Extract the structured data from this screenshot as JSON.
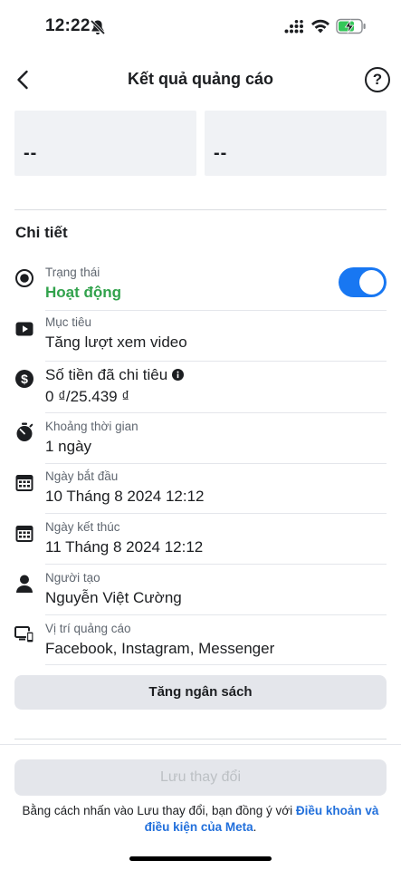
{
  "status_bar": {
    "time": "12:22"
  },
  "header": {
    "title": "Kết quả quảng cáo",
    "help_label": "?"
  },
  "metrics": [
    {
      "value": "--"
    },
    {
      "value": "--"
    }
  ],
  "details": {
    "title": "Chi tiết",
    "rows": [
      {
        "label": "Trạng thái",
        "value": "Hoạt động",
        "icon": "radio-status-icon",
        "status_color": "#31a24c"
      },
      {
        "label": "Mục tiêu",
        "value": "Tăng lượt xem video",
        "icon": "video-play-icon"
      },
      {
        "label": "Số tiền đã chi tiêu",
        "value": "0 ₫/25.439 ₫",
        "icon": "dollar-circle-icon"
      },
      {
        "label": "Khoảng thời gian",
        "value": "1 ngày",
        "icon": "stopwatch-icon"
      },
      {
        "label": "Ngày bắt đầu",
        "value": "10 Tháng 8 2024 12:12",
        "icon": "calendar-icon"
      },
      {
        "label": "Ngày kết thúc",
        "value": "11 Tháng 8 2024 12:12",
        "icon": "calendar-icon"
      },
      {
        "label": "Người tạo",
        "value": "Nguyễn Việt Cường",
        "icon": "person-icon"
      },
      {
        "label": "Vị trí quảng cáo",
        "value": "Facebook, Instagram, Messenger",
        "icon": "devices-icon"
      }
    ],
    "status_toggle_on": true
  },
  "actions": {
    "increase_budget": "Tăng ngân sách",
    "save_changes": "Lưu thay đổi"
  },
  "consent": {
    "prefix": "Bằng cách nhấn vào Lưu thay đổi, bạn đồng ý với ",
    "link": "Điều khoản và điều kiện của Meta",
    "suffix": "."
  },
  "colors": {
    "accent": "#1877f2",
    "link": "#216fdb",
    "status_green": "#31a24c"
  }
}
